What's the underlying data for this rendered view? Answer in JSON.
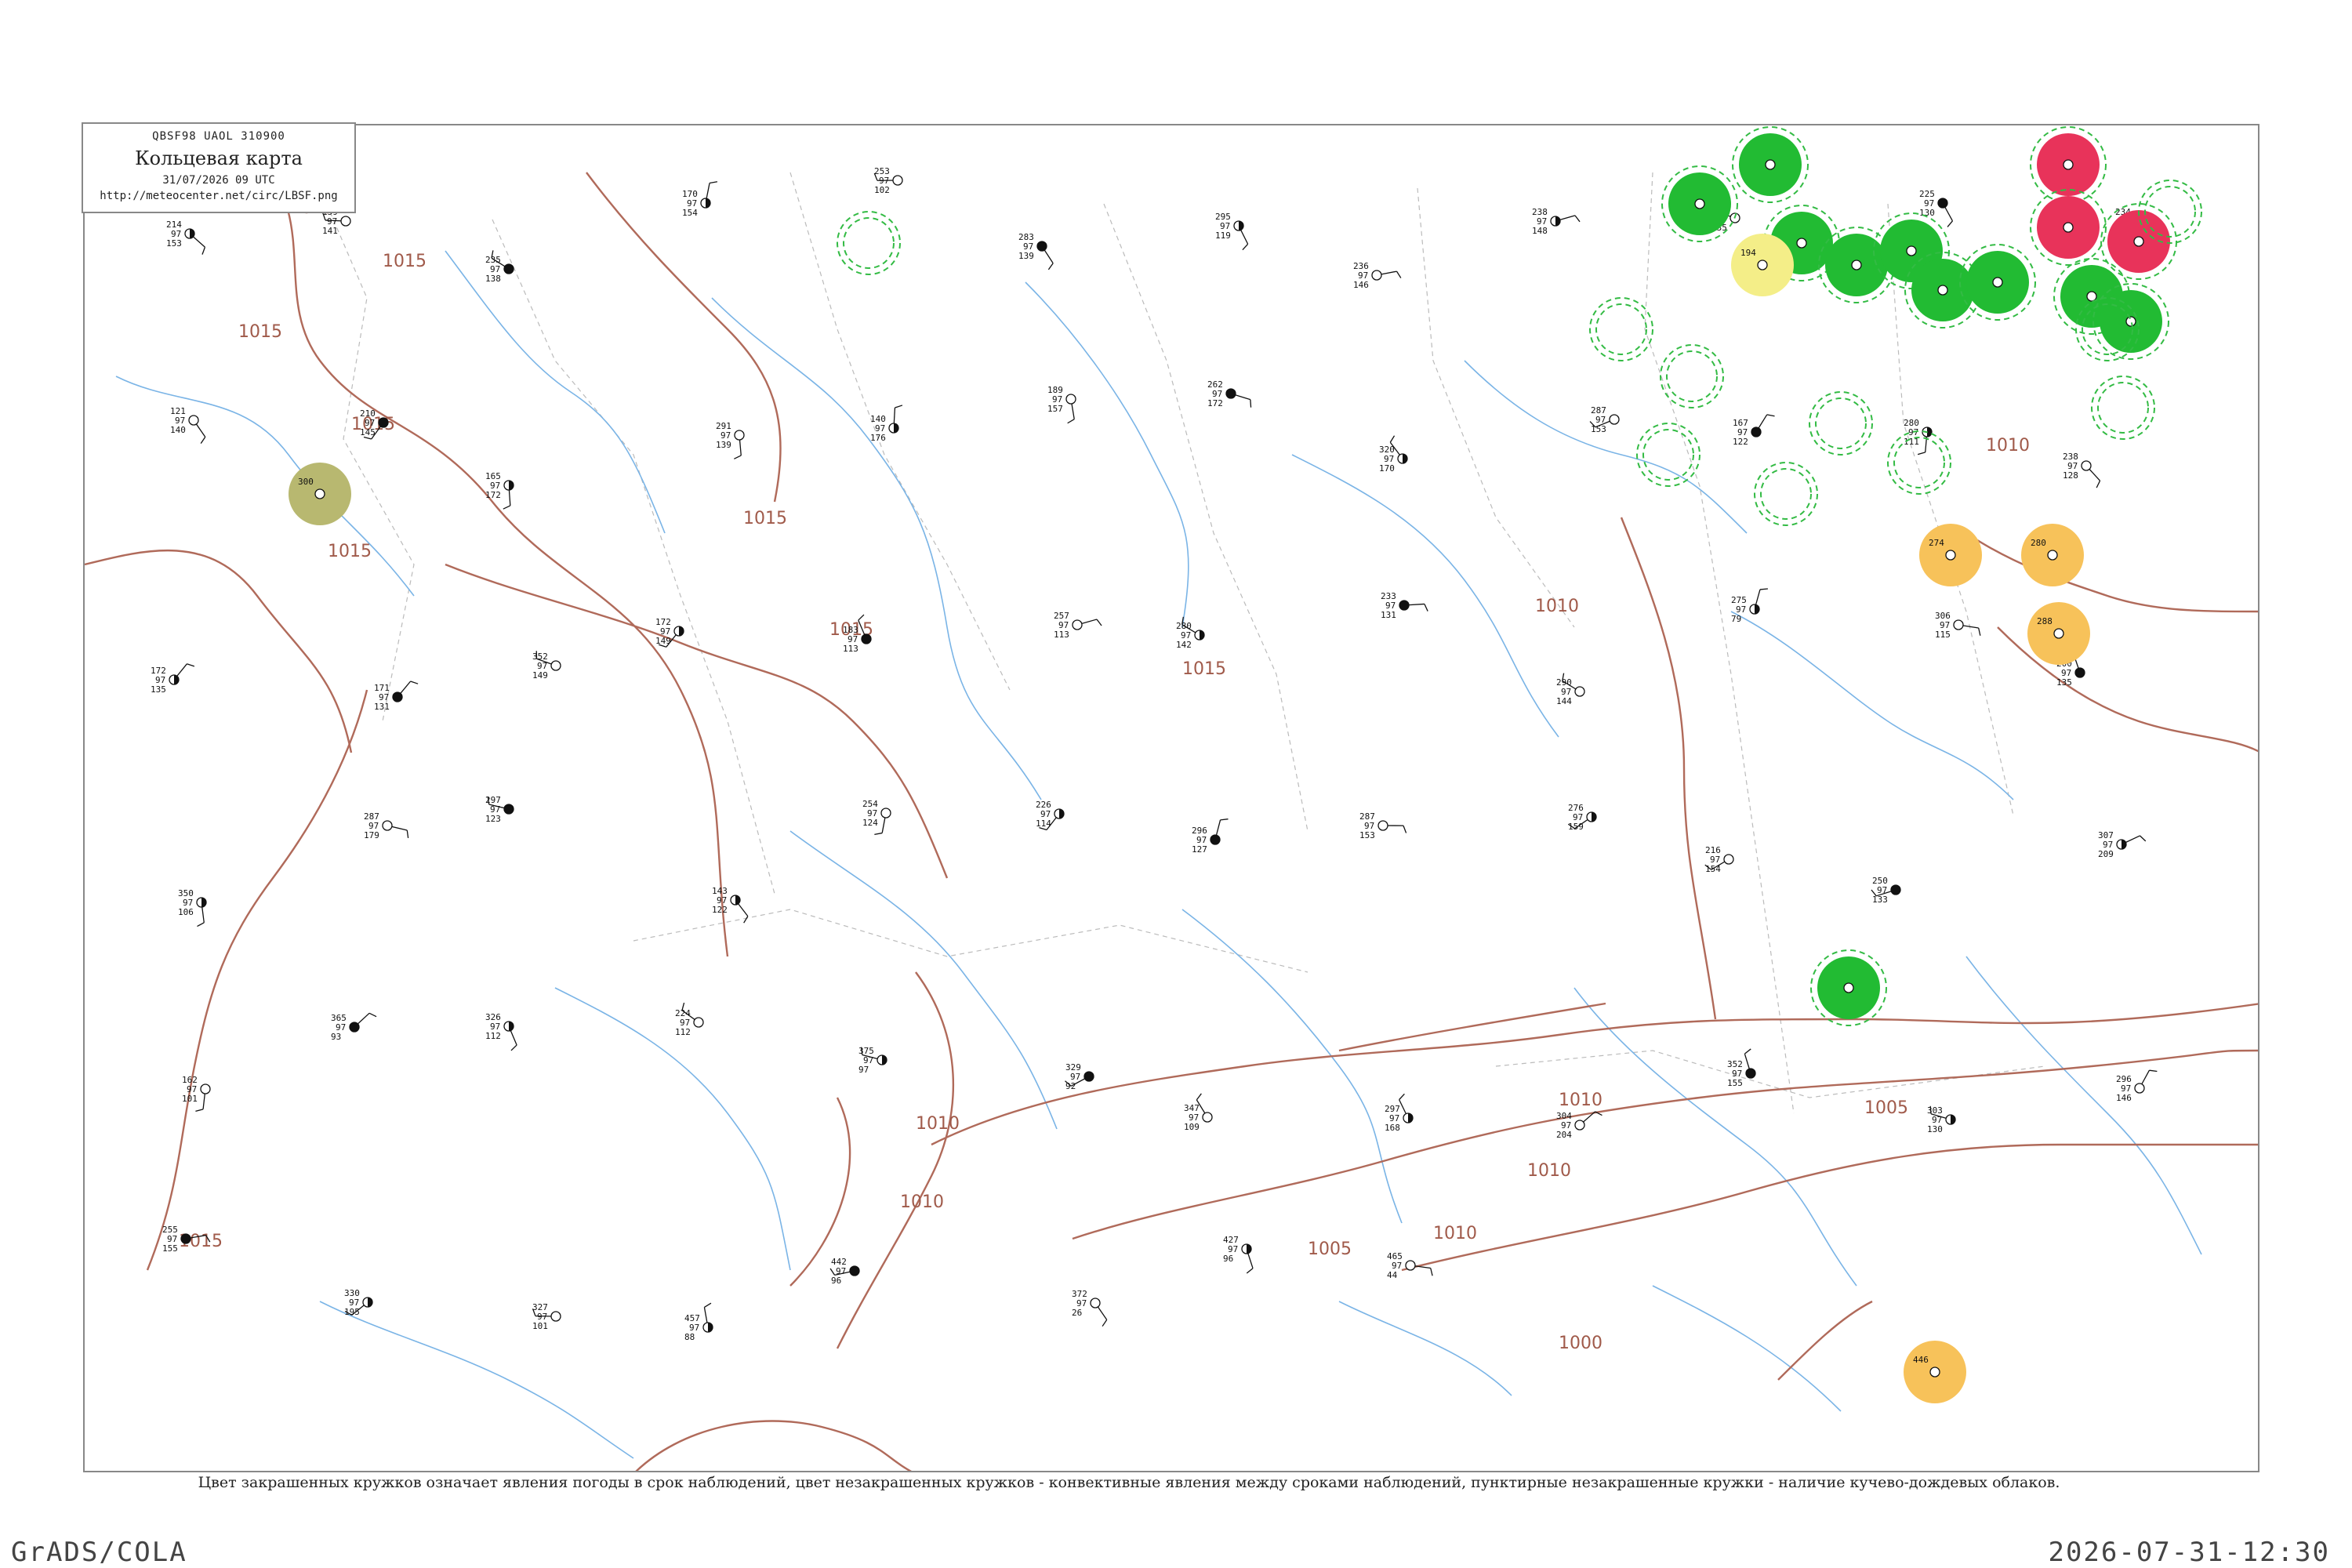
{
  "header": {
    "code": "QBSF98   UAOL   310900",
    "title": "Кольцевая карта",
    "date": "31/07/2026 09 UTC",
    "url": "http://meteocenter.net/circ/LBSF.png"
  },
  "legend_note": "Цвет закрашенных кружков означает явления погоды в срок наблюдений, цвет незакрашенных кружков - конвективные явления между сроками наблюдений, пунктирные незакрашенные кружки - наличие кучево-дождевых облаков.",
  "footer": {
    "left": "GrADS/COLA",
    "right": "2026-07-31-12:30"
  },
  "colors": {
    "isobar": "#b06a5a",
    "river": "#7ab4e6",
    "thunderstorm_green": "#22bb33",
    "rain_yellow": "#f4ee88",
    "shower_red": "#e8335a",
    "haze_orange": "#f7c25a",
    "mist_olive": "#b8b870",
    "cb_dashed_green": "#33bb44"
  },
  "isobar_labels": [
    "1015",
    "1015",
    "1015",
    "1015",
    "1015",
    "1015",
    "1015",
    "1015",
    "1010",
    "1010",
    "1010",
    "1010",
    "1010",
    "1010",
    "1005",
    "1005",
    "1000",
    "1010",
    "1015"
  ],
  "stations": [
    {
      "p": "214",
      "t": "97",
      "d": "153",
      "cover": "half"
    },
    {
      "p": "159",
      "t": "97",
      "d": "141",
      "cover": "clear"
    },
    {
      "p": "235",
      "t": "97",
      "d": "138",
      "cover": "full"
    },
    {
      "p": "170",
      "t": "97",
      "d": "154",
      "cover": "half"
    },
    {
      "p": "253",
      "t": "97",
      "d": "102",
      "cover": "clear"
    },
    {
      "p": "283",
      "t": "97",
      "d": "139",
      "cover": "full"
    },
    {
      "p": "295",
      "t": "97",
      "d": "119",
      "cover": "half"
    },
    {
      "p": "236",
      "t": "97",
      "d": "146",
      "cover": "clear"
    },
    {
      "p": "238",
      "t": "97",
      "d": "148",
      "cover": "half"
    },
    {
      "p": "190",
      "t": "97",
      "d": "135",
      "cover": "clear"
    },
    {
      "p": "225",
      "t": "97",
      "d": "130",
      "cover": "full"
    },
    {
      "p": "234",
      "t": "97",
      "d": "144",
      "cover": "half"
    },
    {
      "p": "121",
      "t": "97",
      "d": "140",
      "cover": "clear"
    },
    {
      "p": "210",
      "t": "97",
      "d": "145",
      "cover": "full"
    },
    {
      "p": "165",
      "t": "97",
      "d": "172",
      "cover": "half"
    },
    {
      "p": "291",
      "t": "97",
      "d": "139",
      "cover": "clear"
    },
    {
      "p": "140",
      "t": "97",
      "d": "176",
      "cover": "half"
    },
    {
      "p": "189",
      "t": "97",
      "d": "157",
      "cover": "clear"
    },
    {
      "p": "262",
      "t": "97",
      "d": "172",
      "cover": "full"
    },
    {
      "p": "320",
      "t": "97",
      "d": "170",
      "cover": "half"
    },
    {
      "p": "287",
      "t": "97",
      "d": "153",
      "cover": "clear"
    },
    {
      "p": "167",
      "t": "97",
      "d": "122",
      "cover": "full"
    },
    {
      "p": "280",
      "t": "97",
      "d": "111",
      "cover": "half"
    },
    {
      "p": "238",
      "t": "97",
      "d": "128",
      "cover": "clear"
    },
    {
      "p": "172",
      "t": "97",
      "d": "135",
      "cover": "half"
    },
    {
      "p": "171",
      "t": "97",
      "d": "131",
      "cover": "full"
    },
    {
      "p": "352",
      "t": "97",
      "d": "149",
      "cover": "clear"
    },
    {
      "p": "172",
      "t": "97",
      "d": "149",
      "cover": "half"
    },
    {
      "p": "183",
      "t": "97",
      "d": "113",
      "cover": "full"
    },
    {
      "p": "257",
      "t": "97",
      "d": "113",
      "cover": "clear"
    },
    {
      "p": "280",
      "t": "97",
      "d": "142",
      "cover": "half"
    },
    {
      "p": "233",
      "t": "97",
      "d": "131",
      "cover": "full"
    },
    {
      "p": "290",
      "t": "97",
      "d": "144",
      "cover": "clear"
    },
    {
      "p": "275",
      "t": "97",
      "d": "79",
      "cover": "half"
    },
    {
      "p": "306",
      "t": "97",
      "d": "115",
      "cover": "clear"
    },
    {
      "p": "200",
      "t": "97",
      "d": "135",
      "cover": "full"
    },
    {
      "p": "350",
      "t": "97",
      "d": "106",
      "cover": "half"
    },
    {
      "p": "287",
      "t": "97",
      "d": "179",
      "cover": "clear"
    },
    {
      "p": "297",
      "t": "97",
      "d": "123",
      "cover": "full"
    },
    {
      "p": "143",
      "t": "97",
      "d": "122",
      "cover": "half"
    },
    {
      "p": "254",
      "t": "97",
      "d": "124",
      "cover": "clear"
    },
    {
      "p": "226",
      "t": "97",
      "d": "114",
      "cover": "half"
    },
    {
      "p": "296",
      "t": "97",
      "d": "127",
      "cover": "full"
    },
    {
      "p": "287",
      "t": "97",
      "d": "153",
      "cover": "clear"
    },
    {
      "p": "276",
      "t": "97",
      "d": "159",
      "cover": "half"
    },
    {
      "p": "216",
      "t": "97",
      "d": "154",
      "cover": "clear"
    },
    {
      "p": "250",
      "t": "97",
      "d": "133",
      "cover": "full"
    },
    {
      "p": "307",
      "t": "97",
      "d": "209",
      "cover": "half"
    },
    {
      "p": "162",
      "t": "97",
      "d": "101",
      "cover": "clear"
    },
    {
      "p": "365",
      "t": "97",
      "d": "93",
      "cover": "full"
    },
    {
      "p": "326",
      "t": "97",
      "d": "112",
      "cover": "half"
    },
    {
      "p": "224",
      "t": "97",
      "d": "112",
      "cover": "clear"
    },
    {
      "p": "375",
      "t": "97",
      "d": "97",
      "cover": "half"
    },
    {
      "p": "329",
      "t": "97",
      "d": "92",
      "cover": "full"
    },
    {
      "p": "347",
      "t": "97",
      "d": "109",
      "cover": "clear"
    },
    {
      "p": "297",
      "t": "97",
      "d": "168",
      "cover": "half"
    },
    {
      "p": "304",
      "t": "97",
      "d": "204",
      "cover": "clear"
    },
    {
      "p": "352",
      "t": "97",
      "d": "155",
      "cover": "full"
    },
    {
      "p": "303",
      "t": "97",
      "d": "130",
      "cover": "half"
    },
    {
      "p": "296",
      "t": "97",
      "d": "146",
      "cover": "clear"
    },
    {
      "p": "255",
      "t": "97",
      "d": "155",
      "cover": "full"
    },
    {
      "p": "330",
      "t": "97",
      "d": "195",
      "cover": "half"
    },
    {
      "p": "327",
      "t": "97",
      "d": "101",
      "cover": "clear"
    },
    {
      "p": "457",
      "t": "97",
      "d": "88",
      "cover": "half"
    },
    {
      "p": "442",
      "t": "97",
      "d": "96",
      "cover": "full"
    },
    {
      "p": "372",
      "t": "97",
      "d": "26",
      "cover": "clear"
    },
    {
      "p": "427",
      "t": "97",
      "d": "96",
      "cover": "half"
    },
    {
      "p": "465",
      "t": "97",
      "d": "44",
      "cover": "clear"
    }
  ],
  "weather_circles": [
    {
      "kind": "thunderstorm",
      "label": ""
    },
    {
      "kind": "thunderstorm",
      "label": ""
    },
    {
      "kind": "thunderstorm",
      "label": ""
    },
    {
      "kind": "rain",
      "label": "194"
    },
    {
      "kind": "thunderstorm",
      "label": ""
    },
    {
      "kind": "thunderstorm",
      "label": ""
    },
    {
      "kind": "thunderstorm",
      "label": ""
    },
    {
      "kind": "thunderstorm",
      "label": ""
    },
    {
      "kind": "shower",
      "label": ""
    },
    {
      "kind": "shower",
      "label": ""
    },
    {
      "kind": "shower",
      "label": ""
    },
    {
      "kind": "thunderstorm",
      "label": ""
    },
    {
      "kind": "thunderstorm",
      "label": ""
    },
    {
      "kind": "haze",
      "label": "274"
    },
    {
      "kind": "haze",
      "label": "280"
    },
    {
      "kind": "haze",
      "label": "288"
    },
    {
      "kind": "thunderstorm",
      "label": ""
    },
    {
      "kind": "haze",
      "label": "446"
    },
    {
      "kind": "mist",
      "label": "300"
    },
    {
      "kind": "cb",
      "label": ""
    },
    {
      "kind": "cb",
      "label": ""
    },
    {
      "kind": "cb",
      "label": ""
    },
    {
      "kind": "cb",
      "label": ""
    },
    {
      "kind": "cb",
      "label": ""
    },
    {
      "kind": "cb",
      "label": ""
    },
    {
      "kind": "cb",
      "label": ""
    },
    {
      "kind": "cb",
      "label": ""
    },
    {
      "kind": "cb",
      "label": ""
    },
    {
      "kind": "cb",
      "label": ""
    }
  ]
}
